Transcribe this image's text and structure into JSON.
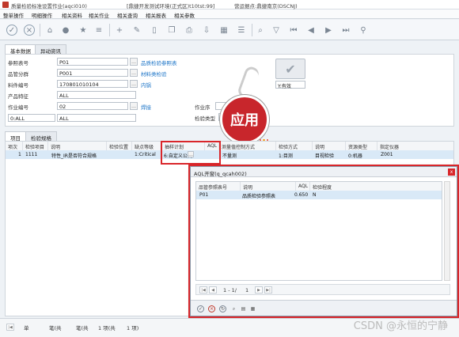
{
  "titlebar": {
    "app_title": "质量检验标准设置作业(aqci010)",
    "env": "[鼎捷开发测试环境(正式区)t10tst:99]",
    "site": "营运据点:鼎捷南京(DSCNJ)"
  },
  "menubar": [
    "整单操作",
    "明细操作",
    "相关资料",
    "相关作业",
    "相关查询",
    "相关报表",
    "相关参数"
  ],
  "tabs": {
    "main": [
      "基本数据",
      "异动资讯"
    ],
    "detail": [
      "项目",
      "检验规格"
    ]
  },
  "form": {
    "label_ref_no": "参照表号",
    "ref_no": "P01",
    "ref_no_desc": "品质检验参照表",
    "label_category": "品管分群",
    "category": "P001",
    "category_desc": "材料类检验",
    "label_item_no": "料件编号",
    "item_no": "170801010104",
    "item_desc": "内锅",
    "label_feature": "产品特征",
    "feature": "ALL",
    "label_op_no": "作业编号",
    "op_no": "02",
    "op_desc": "焊接",
    "combo_val": "0:ALL",
    "combo_val2": "ALL",
    "label_station": "作业序",
    "label_check_type": "检验类型",
    "status": "Y:有效"
  },
  "grid": {
    "headers": [
      "项次",
      "检验项目",
      "说明",
      "检验位置",
      "缺点等级",
      "抽样计划",
      "AQL",
      "测量值控制方式",
      "检验方式",
      "说明",
      "资源类型",
      "指定仪器"
    ],
    "row": [
      "1",
      "1111",
      "特性_IR是否符合规格",
      "",
      "1:Critical",
      "6:自定义公式",
      "",
      "不量测",
      "1:目测",
      "目视检验",
      "0:机器",
      "Z001"
    ]
  },
  "apply_label": "应用",
  "dialog": {
    "title": "AQL开窗(q_qcah002)",
    "close": "x",
    "headers": [
      "品管参照表号",
      "说明",
      "AQL",
      "检验程度"
    ],
    "row": [
      "P01",
      "品质检验参照表",
      "0.650",
      "N"
    ],
    "page": "1 - 1/",
    "page_total": "1"
  },
  "footer": {
    "item1": "单",
    "item2": "笔(共",
    "item3": "笔(共",
    "item4": "1 项(共",
    "item5": "1 项)"
  },
  "watermark": "CSDN @永恒的宁静",
  "colors": {
    "highlight_red": "#d9262a",
    "apply_red": "#c8262c",
    "link": "#1a73c7",
    "selected_row": "#d9e9f7"
  }
}
